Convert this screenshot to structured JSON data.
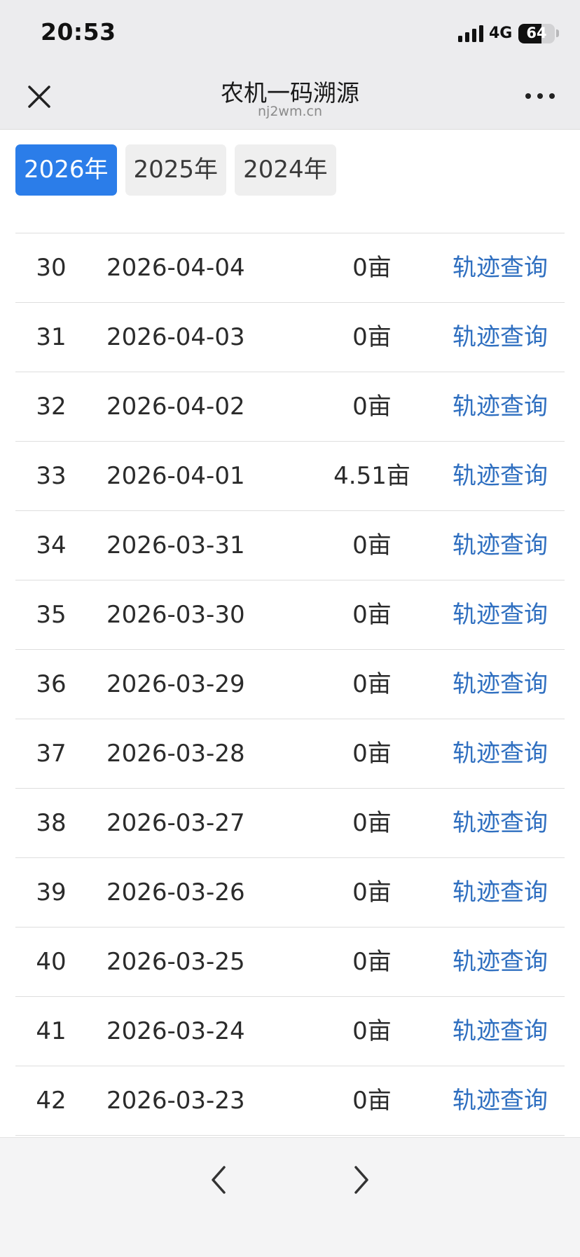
{
  "status_bar": {
    "time": "20:53",
    "network": "4G",
    "battery_percent": 64,
    "battery_text": "64"
  },
  "nav": {
    "title": "农机一码溯源",
    "subtitle": "nj2wm.cn",
    "close_icon": "close-icon",
    "more_icon": "more-dots-icon"
  },
  "year_tabs": [
    {
      "label": "2026年",
      "active": true
    },
    {
      "label": "2025年",
      "active": false
    },
    {
      "label": "2024年",
      "active": false
    }
  ],
  "records": [
    {
      "index": "30",
      "date": "2026-04-04",
      "area": "0亩",
      "action": "轨迹查询"
    },
    {
      "index": "31",
      "date": "2026-04-03",
      "area": "0亩",
      "action": "轨迹查询"
    },
    {
      "index": "32",
      "date": "2026-04-02",
      "area": "0亩",
      "action": "轨迹查询"
    },
    {
      "index": "33",
      "date": "2026-04-01",
      "area": "4.51亩",
      "action": "轨迹查询"
    },
    {
      "index": "34",
      "date": "2026-03-31",
      "area": "0亩",
      "action": "轨迹查询"
    },
    {
      "index": "35",
      "date": "2026-03-30",
      "area": "0亩",
      "action": "轨迹查询"
    },
    {
      "index": "36",
      "date": "2026-03-29",
      "area": "0亩",
      "action": "轨迹查询"
    },
    {
      "index": "37",
      "date": "2026-03-28",
      "area": "0亩",
      "action": "轨迹查询"
    },
    {
      "index": "38",
      "date": "2026-03-27",
      "area": "0亩",
      "action": "轨迹查询"
    },
    {
      "index": "39",
      "date": "2026-03-26",
      "area": "0亩",
      "action": "轨迹查询"
    },
    {
      "index": "40",
      "date": "2026-03-25",
      "area": "0亩",
      "action": "轨迹查询"
    },
    {
      "index": "41",
      "date": "2026-03-24",
      "area": "0亩",
      "action": "轨迹查询"
    },
    {
      "index": "42",
      "date": "2026-03-23",
      "area": "0亩",
      "action": "轨迹查询"
    }
  ],
  "pagination": {
    "prev_icon": "chevron-left-icon",
    "next_icon": "chevron-right-icon"
  },
  "colors": {
    "accent": "#2b7de9",
    "link": "#2f6fc0",
    "header_bg": "#ececee"
  }
}
